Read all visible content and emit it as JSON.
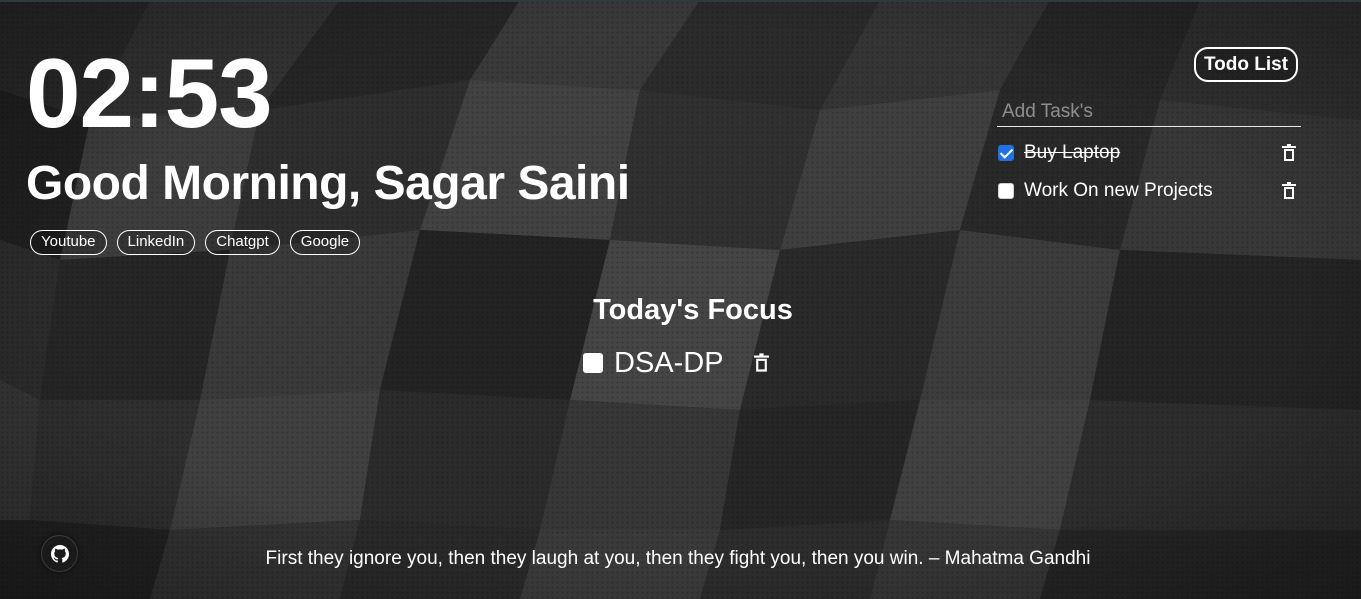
{
  "clock": {
    "time": "02:53"
  },
  "greeting": {
    "text": "Good Morning, Sagar Saini"
  },
  "links": [
    {
      "label": "Youtube"
    },
    {
      "label": "LinkedIn"
    },
    {
      "label": "Chatgpt"
    },
    {
      "label": "Google"
    }
  ],
  "todo": {
    "button_label": "Todo List",
    "input_placeholder": "Add Task's",
    "input_value": "",
    "tasks": [
      {
        "text": "Buy Laptop",
        "done": true
      },
      {
        "text": "Work On new Projects",
        "done": false
      }
    ]
  },
  "focus": {
    "title": "Today's Focus",
    "task": "DSA-DP",
    "done": false
  },
  "quote": {
    "text": "First they ignore you, then they laugh at you, then they fight you, then you win. – Mahatma Gandhi"
  },
  "icons": {
    "trash": "trash-icon",
    "github": "github-icon"
  },
  "colors": {
    "checkbox_checked": "#1f73e6",
    "background": "#1e1e1e",
    "text": "#ffffff"
  }
}
